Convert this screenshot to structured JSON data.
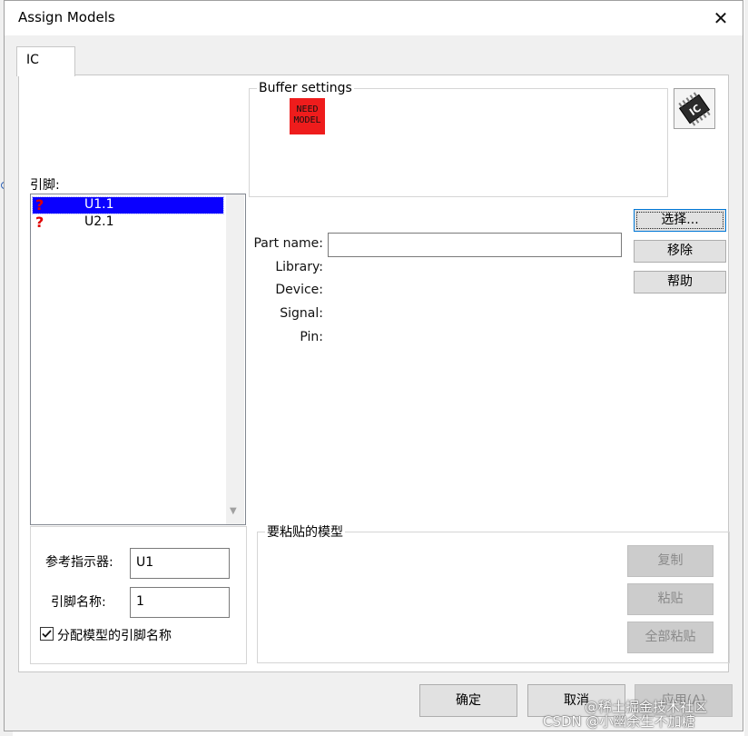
{
  "window": {
    "title": "Assign Models",
    "close_glyph": "✕"
  },
  "tabs": [
    {
      "label": "IC"
    }
  ],
  "buffer_settings": {
    "legend": "Buffer settings",
    "need_model_line1": "NEED",
    "need_model_line2": "MODEL",
    "chip_text": "IC"
  },
  "pins": {
    "label": "引脚:",
    "items": [
      {
        "marker": "?",
        "name": "U1.1",
        "selected": true
      },
      {
        "marker": "?",
        "name": "U2.1",
        "selected": false
      }
    ]
  },
  "details": {
    "part_name_label": "Part name:",
    "part_name_value": "",
    "library_label": "Library:",
    "device_label": "Device:",
    "signal_label": "Signal:",
    "pin_label": "Pin:"
  },
  "side_buttons": {
    "select": "选择...",
    "remove": "移除",
    "help": "帮助"
  },
  "reference": {
    "ref_designator_label": "参考指示器:",
    "ref_designator_value": "U1",
    "pin_name_label": "引脚名称:",
    "pin_name_value": "1",
    "assign_checkbox_label": "分配模型的引脚名称",
    "assign_checkbox_checked": true
  },
  "paste_models": {
    "legend": "要粘贴的模型",
    "copy": "复制",
    "paste": "粘贴",
    "paste_all": "全部粘贴"
  },
  "footer": {
    "ok": "确定",
    "cancel": "取消",
    "apply": "应用(A)"
  },
  "watermark": {
    "line1": "@稀土掘金技术社区",
    "line2": "CSDN @小幽余生不加糖"
  },
  "colors": {
    "selection": "#0a00ff",
    "need_model_bg": "#ee1c1c",
    "focus_border": "#0078d7"
  }
}
